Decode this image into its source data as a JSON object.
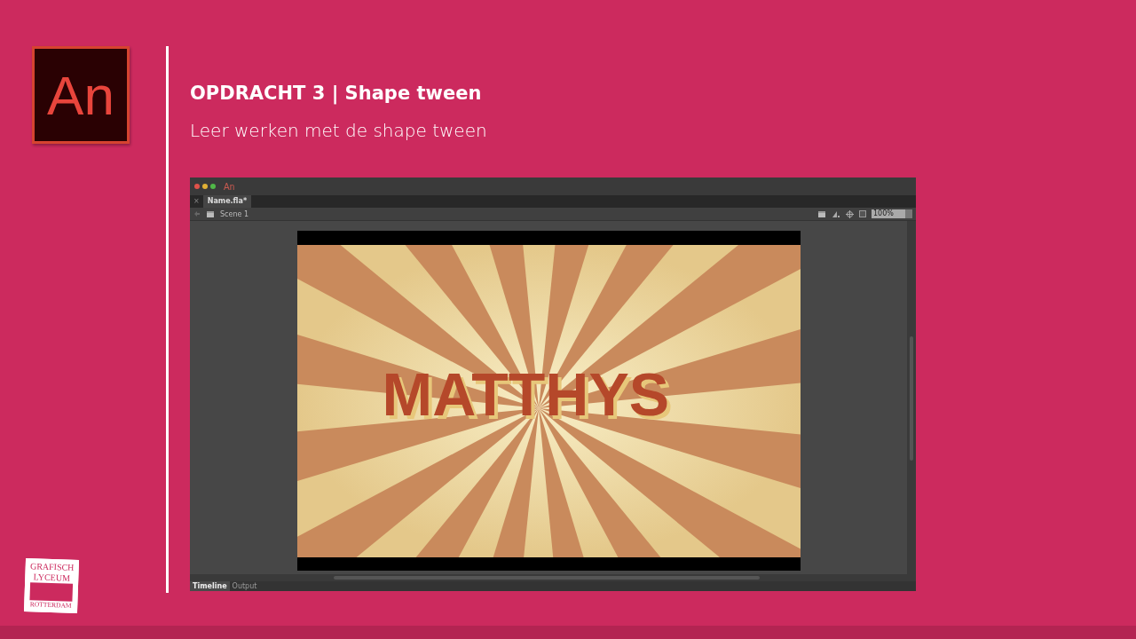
{
  "slide": {
    "logo_text": "An",
    "title": "OPDRACHT 3 | Shape tween",
    "subtitle": "Leer werken met de shape tween"
  },
  "app": {
    "title_logo": "An",
    "close_glyph": "×",
    "document_tabs": [
      {
        "label": "Name.fla*",
        "selected": true
      }
    ],
    "scene": "Scene 1",
    "zoom": "100%",
    "stage_text": "MATTHYS",
    "panel_tabs": [
      {
        "label": "Timeline",
        "selected": true
      },
      {
        "label": "Output",
        "selected": false
      }
    ]
  },
  "school_logo": {
    "top_lines": [
      "GRAFISCH",
      "LYCEUM"
    ],
    "bottom_line": "ROTTERDAM"
  }
}
